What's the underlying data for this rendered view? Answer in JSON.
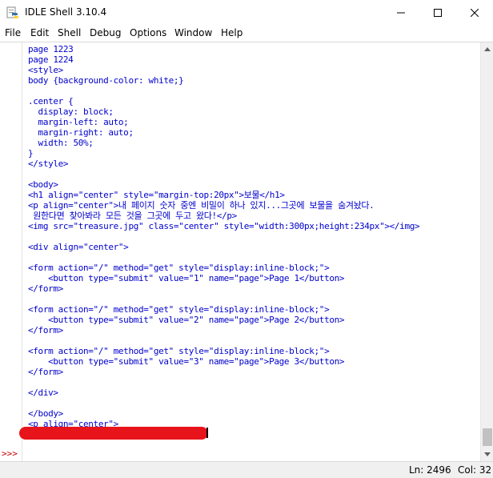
{
  "window": {
    "title": "IDLE Shell 3.10.4",
    "icon": "python-idle-icon",
    "controls": [
      "minimize-icon",
      "maximize-icon",
      "close-icon"
    ]
  },
  "menu": [
    "File",
    "Edit",
    "Shell",
    "Debug",
    "Options",
    "Window",
    "Help"
  ],
  "shell": {
    "prompt": ">>>",
    "lines": [
      "page 1223",
      "page 1224",
      "<style>",
      "body {background-color: white;}",
      "",
      ".center {",
      "  display: block;",
      "  margin-left: auto;",
      "  margin-right: auto;",
      "  width: 50%;",
      "}",
      "</style>",
      "",
      "<body>",
      "<h1 align=\"center\" style=\"margin-top:20px\">보물</h1>",
      "<p align=\"center\">내 페이지 숫자 중엔 비밀이 하나 있지...그곳에 보물을 숨겨놨다.",
      " 원한다면 찾아봐라 모든 것을 그곳에 두고 왔다!</p>",
      "<img src=\"treasure.jpg\" class=\"center\" style=\"width:300px;height:234px\"></img>",
      "",
      "<div align=\"center\">",
      "",
      "<form action=\"/\" method=\"get\" style=\"display:inline-block;\">",
      "    <button type=\"submit\" value=\"1\" name=\"page\">Page 1</button>",
      "</form>",
      "",
      "<form action=\"/\" method=\"get\" style=\"display:inline-block;\">",
      "    <button type=\"submit\" value=\"2\" name=\"page\">Page 2</button>",
      "</form>",
      "",
      "<form action=\"/\" method=\"get\" style=\"display:inline-block;\">",
      "    <button type=\"submit\" value=\"3\" name=\"page\">Page 3</button>",
      "</form>",
      "",
      "</div>",
      "",
      "</body>",
      "<p align=\"center\">"
    ],
    "text_color": "#0000cc",
    "prompt_color": "#c00000",
    "redaction_color": "#e8141b"
  },
  "status": {
    "line": "Ln: 2496",
    "column": "Col: 32"
  }
}
